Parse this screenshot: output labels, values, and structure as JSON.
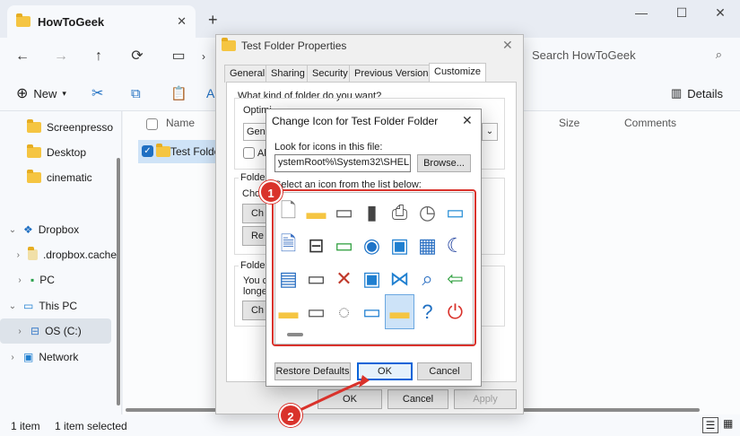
{
  "explorer": {
    "tab_title": "HowToGeek",
    "search_placeholder": "Search HowToGeek",
    "toolbar": {
      "new_label": "New",
      "details_label": "Details"
    },
    "columns": {
      "name": "Name",
      "size": "Size",
      "comments": "Comments"
    },
    "row_name": "Test Folder",
    "sidebar": {
      "items": [
        {
          "label": "Screenpresso"
        },
        {
          "label": "Desktop"
        },
        {
          "label": "cinematic"
        },
        {
          "label": "Dropbox"
        },
        {
          "label": ".dropbox.cache"
        },
        {
          "label": "PC"
        },
        {
          "label": "This PC"
        },
        {
          "label": "OS (C:)"
        },
        {
          "label": "Network"
        }
      ]
    },
    "status": {
      "count": "1 item",
      "selected": "1 item selected"
    }
  },
  "properties": {
    "title": "Test Folder Properties",
    "tabs": [
      "General",
      "Sharing",
      "Security",
      "Previous Versions",
      "Customize"
    ],
    "active_tab": "Customize",
    "question": "What kind of folder do you want?",
    "optimize_fragment": "Optimi",
    "optimize_tail": "r for:",
    "dropdown_fragment": "Gen",
    "checkbox_fragment": "Als",
    "pictures_fragment": "Folder",
    "choose_fragment": "Choo",
    "btn1_fragment": "Ch",
    "btn2_fragment": "Re",
    "icons_fragment": "Folder",
    "you_can_fragment": "You ca",
    "longer_fragment": "longe",
    "btn3_fragment": "Ch",
    "ok_label": "OK",
    "cancel_label": "Cancel",
    "apply_label": "Apply"
  },
  "change_icon": {
    "title": "Change Icon for Test Folder Folder",
    "look_label": "Look for icons in this file:",
    "path_value": "ystemRoot%\\System32\\SHELL32.dll",
    "browse_label": "Browse...",
    "select_label": "Select an icon from the list below:",
    "restore_label": "Restore Defaults",
    "ok_label": "OK",
    "cancel_label": "Cancel",
    "icons": [
      "blank-document-icon",
      "folder-icon",
      "drive-icon",
      "memory-chip-icon",
      "printer-icon",
      "clock-document-icon",
      "removable-drive-icon",
      "text-document-icon",
      "network-drive-icon",
      "green-drive-icon",
      "globe-icon",
      "network-monitor-icon",
      "control-panel-icon",
      "moon-monitor-icon",
      "window-icon",
      "floppy-drive-icon",
      "disconnected-drive-icon",
      "globe-monitor-icon",
      "network-icon",
      "search-icon",
      "recycle-arrow-icon",
      "folder-icon",
      "drive-icon",
      "cd-drive-icon",
      "monitor-icon",
      "folder-window-icon",
      "help-icon",
      "power-icon"
    ],
    "selected_index": 25
  },
  "annotations": {
    "badge1": "1",
    "badge2": "2"
  },
  "colors": {
    "accent": "#0a64d8",
    "annotation_red": "#d9322b",
    "folder_yellow": "#f5c542"
  }
}
